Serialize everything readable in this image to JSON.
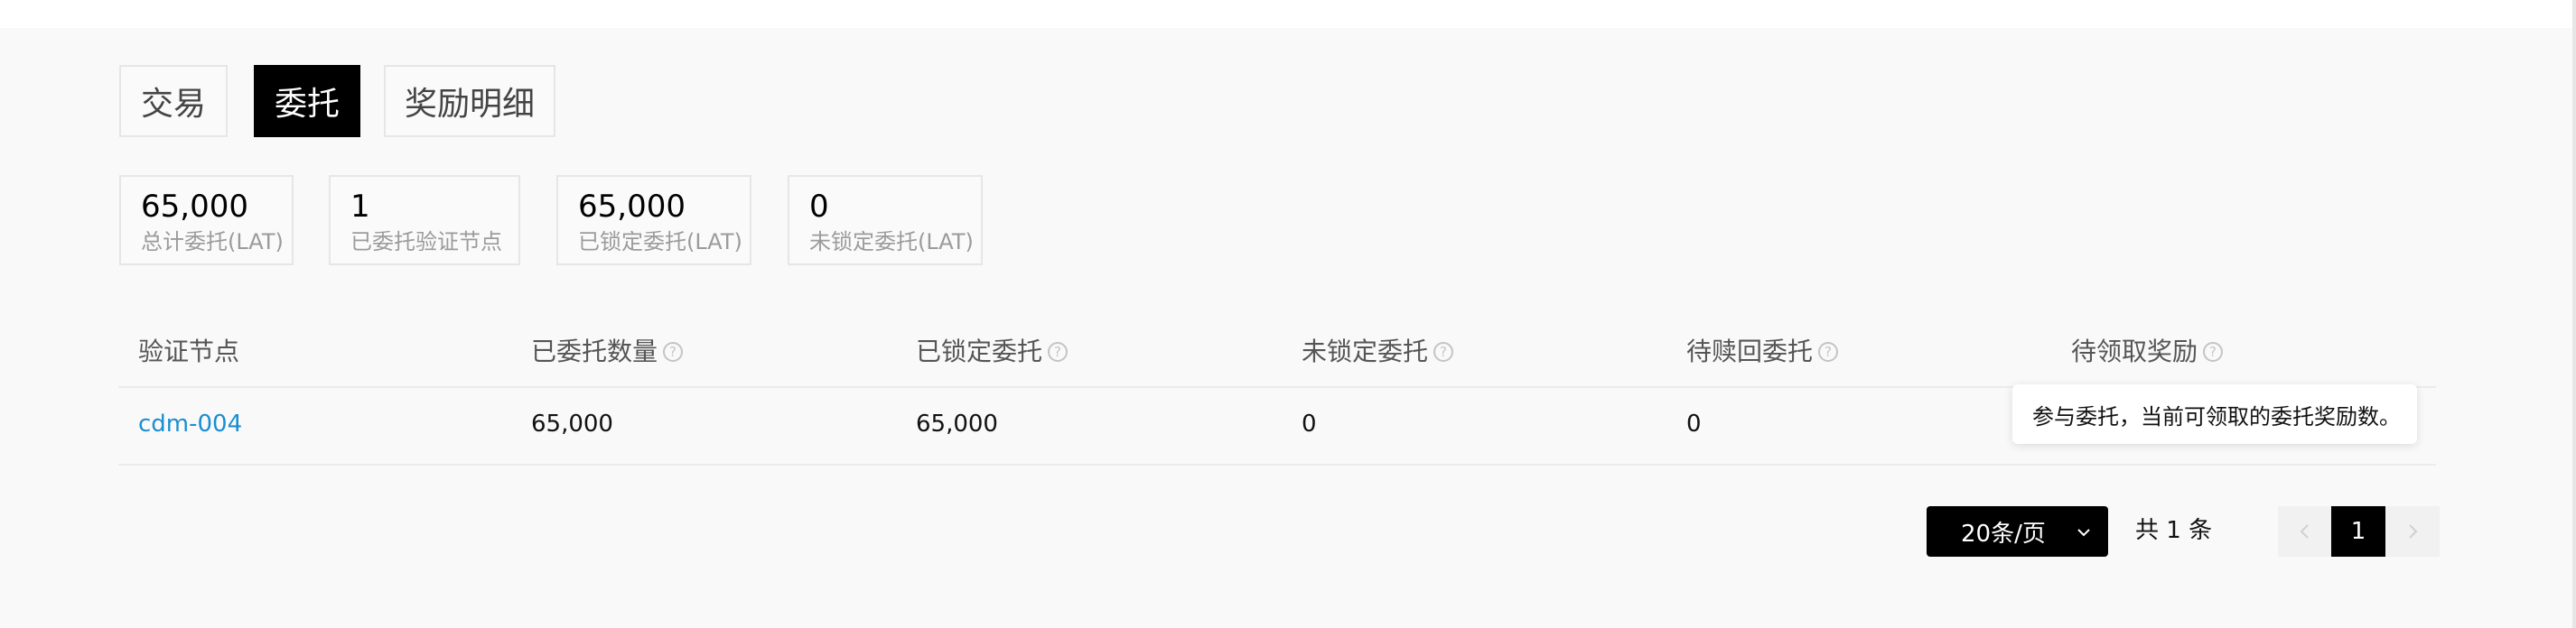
{
  "tabs": [
    {
      "label": "交易"
    },
    {
      "label": "委托",
      "active": true
    },
    {
      "label": "奖励明细"
    }
  ],
  "stats": [
    {
      "value": "65,000",
      "label": "总计委托(LAT)"
    },
    {
      "value": "1",
      "label": "已委托验证节点"
    },
    {
      "value": "65,000",
      "label": "已锁定委托(LAT)"
    },
    {
      "value": "0",
      "label": "未锁定委托(LAT)"
    }
  ],
  "table": {
    "headers": [
      "验证节点",
      "已委托数量",
      "已锁定委托",
      "未锁定委托",
      "待赎回委托",
      "待领取奖励"
    ],
    "rows": [
      [
        "cdm-004",
        "65,000",
        "65,000",
        "0",
        "0"
      ]
    ]
  },
  "tooltip": "参与委托，当前可领取的委托奖励数。",
  "help_icon_glyph": "?",
  "pagination": {
    "page_size": "20条/页",
    "total": "共 1 条",
    "current_page": "1"
  },
  "colors": {
    "link": "#1a8ed1",
    "active_tab": "#000000",
    "panel": "#f9f9f9"
  }
}
